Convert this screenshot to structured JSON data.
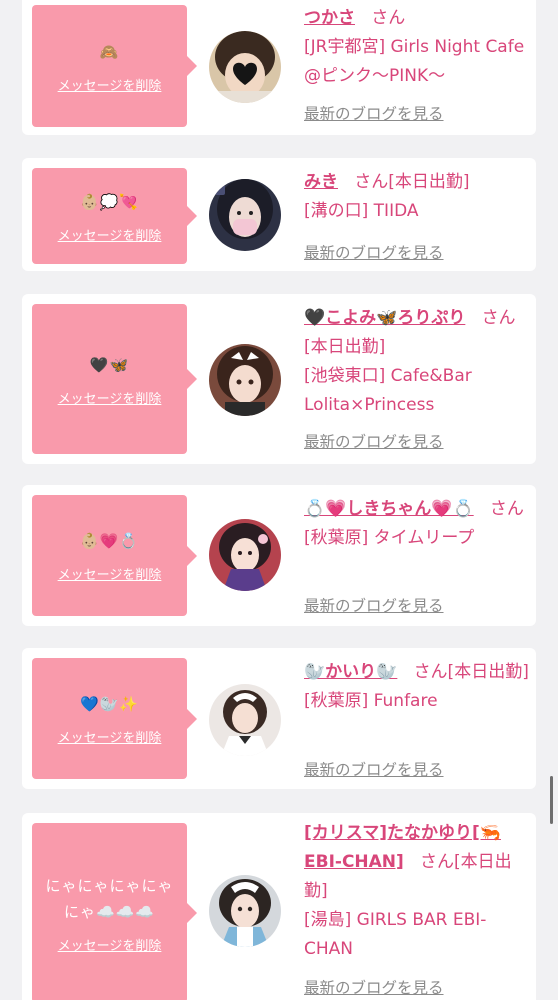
{
  "delete_label": "メッセージを削除",
  "blog_label": "最新のブログを見る",
  "colors": {
    "accent": "#d8467a",
    "bubble": "#f99aab",
    "background": "#f1f1f3",
    "muted": "#8b8b8b"
  },
  "cards": [
    {
      "message": "🙈",
      "name": "つかさ",
      "suffix": "さん",
      "shop": "[JR宇都宮] Girls Night Cafe @ピンク〜PINK〜"
    },
    {
      "message": "👶🏼💭💘",
      "name": "みき",
      "suffix": "さん[本日出勤]",
      "shop": "[溝の口] TIIDA"
    },
    {
      "message": "🖤🦋",
      "name": "🖤こよみ🦋ろりぷり",
      "suffix": "さん[本日出勤]",
      "shop": "[池袋東口] Cafe&Bar Lolita×Princess"
    },
    {
      "message": "👶🏼💗💍",
      "name": "💍💗しきちゃん💗💍",
      "suffix": "さん",
      "shop": "[秋葉原] タイムリープ"
    },
    {
      "message": "💙🦭✨",
      "name": "🦭かいり🦭",
      "suffix": "さん[本日出勤]",
      "shop": "[秋葉原] Funfare"
    },
    {
      "message": "にゃにゃにゃにゃにゃ☁️☁️☁️",
      "name": "[カリスマ]たなかゆり[🦐EBI-CHAN]",
      "suffix": "さん[本日出勤]",
      "shop": "[湯島] GIRLS BAR EBI-CHAN"
    }
  ]
}
